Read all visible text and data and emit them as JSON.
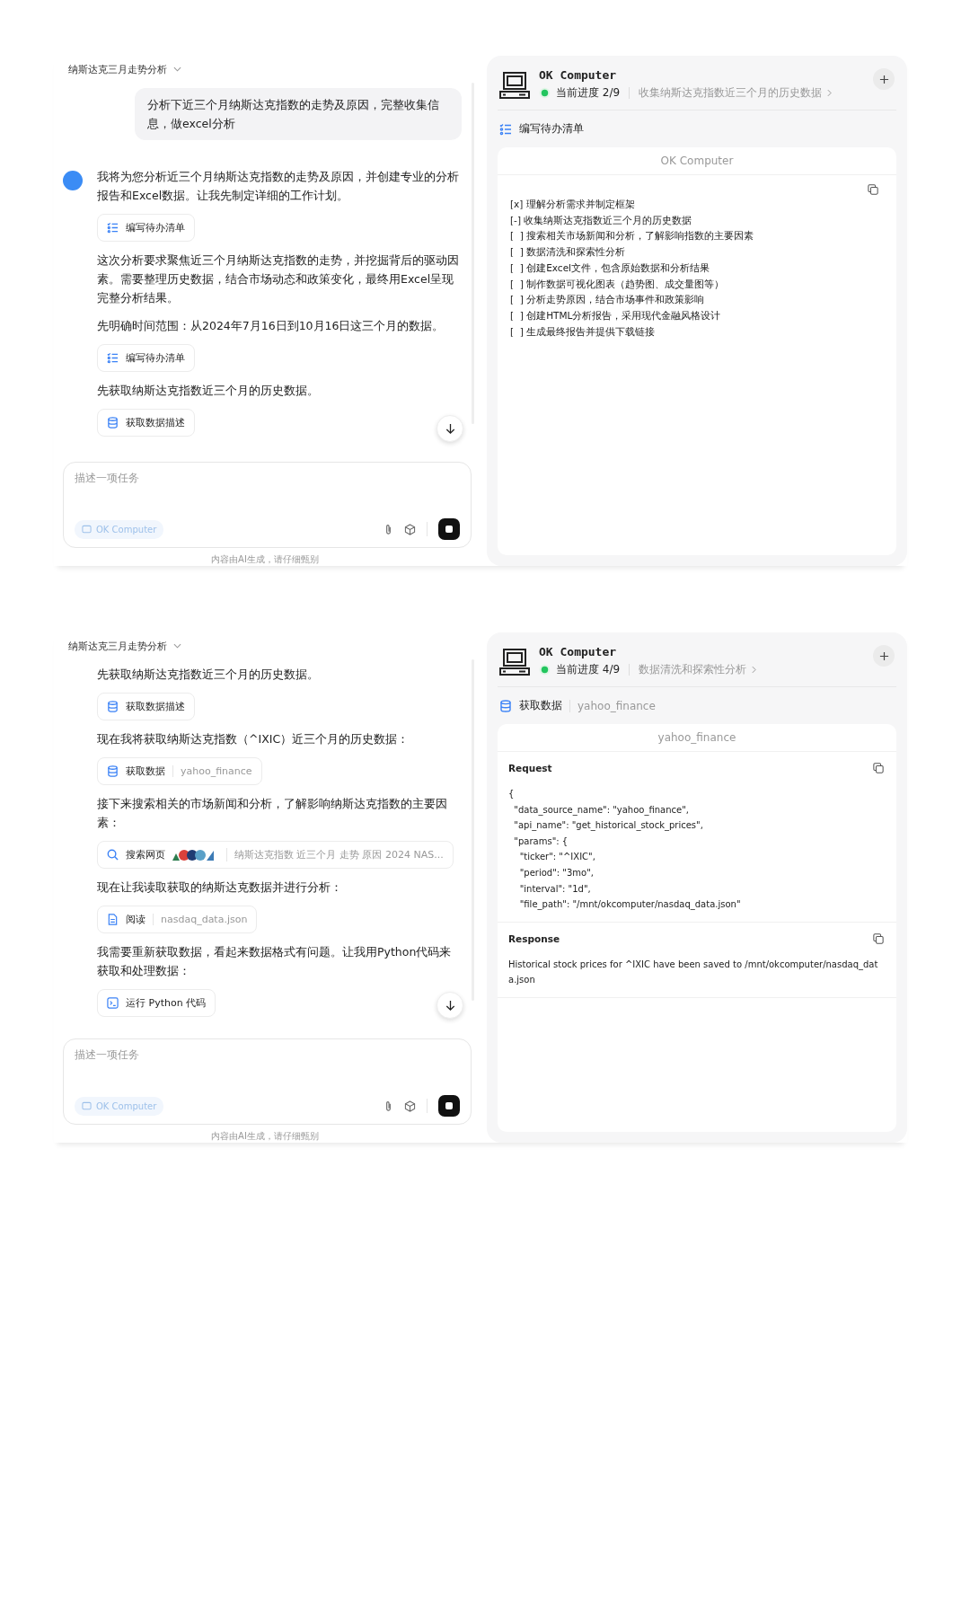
{
  "screens": [
    {
      "chat": {
        "title": "纳斯达克三月走势分析",
        "messages": [
          {
            "kind": "user",
            "text": "分析下近三个月纳斯达克指数的走势及原因，完整收集信息，做excel分析"
          },
          {
            "kind": "assistant",
            "text": "我将为您分析近三个月纳斯达克指数的走势及原因，并创建专业的分析报告和Excel数据。让我先制定详细的工作计划。"
          },
          {
            "kind": "todo",
            "label": "编写待办清单"
          },
          {
            "kind": "text",
            "text": "这次分析要求聚焦近三个月纳斯达克指数的走势，并挖掘背后的驱动因素。需要整理历史数据，结合市场动态和政策变化，最终用Excel呈现完整分析结果。"
          },
          {
            "kind": "text",
            "text": "先明确时间范围：从2024年7月16日到10月16日这三个月的数据。"
          },
          {
            "kind": "todo",
            "label": "编写待办清单"
          },
          {
            "kind": "text",
            "text": "先获取纳斯达克指数近三个月的历史数据。"
          },
          {
            "kind": "database",
            "label": "获取数据描述"
          }
        ],
        "input": {
          "placeholder": "描述一项任务",
          "mode": "OK Computer"
        },
        "disclaimer": "内容由AI生成，请仔细甄别"
      },
      "panel": {
        "title": "OK Computer",
        "progress": "当前进度 2/9",
        "step": "收集纳斯达克指数近三个月的历史数据",
        "tool": {
          "kind": "todo",
          "label": "编写待办清单"
        },
        "card": {
          "kind": "todo",
          "title": "OK Computer",
          "lines": [
            "[x] 理解分析需求并制定框架",
            "[-] 收集纳斯达克指数近三个月的历史数据",
            "[  ] 搜索相关市场新闻和分析，了解影响指数的主要因素",
            "[  ] 数据清洗和探索性分析",
            "[  ] 创建Excel文件，包含原始数据和分析结果",
            "[  ] 制作数据可视化图表（趋势图、成交量图等）",
            "[  ] 分析走势原因，结合市场事件和政策影响",
            "[  ] 创建HTML分析报告，采用现代金融风格设计",
            "[  ] 生成最终报告并提供下载链接"
          ]
        }
      }
    },
    {
      "chat": {
        "title": "纳斯达克三月走势分析",
        "messages": [
          {
            "kind": "text",
            "text": "先获取纳斯达克指数近三个月的历史数据。"
          },
          {
            "kind": "database",
            "label": "获取数据描述"
          },
          {
            "kind": "text",
            "text": "现在我将获取纳斯达克指数（^IXIC）近三个月的历史数据："
          },
          {
            "kind": "database",
            "label": "获取数据",
            "detail": "yahoo_finance"
          },
          {
            "kind": "text",
            "text": "接下来搜索相关的市场新闻和分析，了解影响纳斯达克指数的主要因素："
          },
          {
            "kind": "search",
            "label": "搜索网页",
            "detail": "纳斯达克指数 近三个月 走势 原因 2024 NAS..."
          },
          {
            "kind": "text",
            "text": "现在让我读取获取的纳斯达克数据并进行分析："
          },
          {
            "kind": "file",
            "label": "阅读",
            "detail": "nasdaq_data.json"
          },
          {
            "kind": "text",
            "text": "我需要重新获取数据，看起来数据格式有问题。让我用Python代码来获取和处理数据："
          },
          {
            "kind": "terminal",
            "label": "运行 Python 代码"
          }
        ],
        "input": {
          "placeholder": "描述一项任务",
          "mode": "OK Computer"
        },
        "disclaimer": "内容由AI生成，请仔细甄别"
      },
      "panel": {
        "title": "OK Computer",
        "progress": "当前进度 4/9",
        "step": "数据清洗和探索性分析",
        "tool": {
          "kind": "database",
          "label": "获取数据",
          "detail": "yahoo_finance"
        },
        "card": {
          "kind": "api",
          "title": "yahoo_finance",
          "sections": [
            {
              "title": "Request",
              "body": "{\n  \"data_source_name\": \"yahoo_finance\",\n  \"api_name\": \"get_historical_stock_prices\",\n  \"params\": {\n    \"ticker\": \"^IXIC\",\n    \"period\": \"3mo\",\n    \"interval\": \"1d\",\n    \"file_path\": \"/mnt/okcomputer/nasdaq_data.json\""
            },
            {
              "title": "Response",
              "body": "Historical stock prices for ^IXIC have been saved to /mnt/okcomputer/nasdaq_data.json"
            }
          ]
        }
      }
    }
  ]
}
